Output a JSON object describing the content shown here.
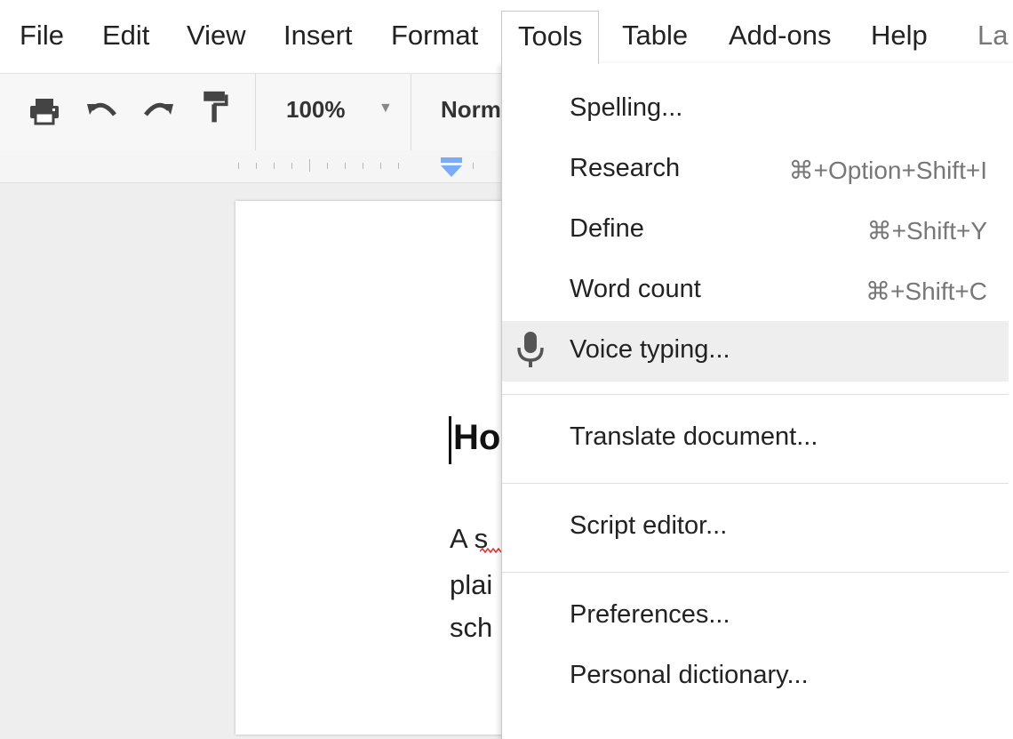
{
  "menubar": {
    "items": [
      "File",
      "Edit",
      "View",
      "Insert",
      "Format",
      "Tools",
      "Table",
      "Add-ons",
      "Help",
      "La"
    ],
    "active_index": 5
  },
  "toolbar": {
    "icons": [
      "print-icon",
      "undo-icon",
      "redo-icon",
      "paint-format-icon"
    ],
    "zoom": "100%",
    "style": "Norm"
  },
  "document": {
    "heading": "Ho",
    "lines": [
      "A s",
      "plai",
      "sch"
    ]
  },
  "tools_menu": {
    "items": [
      {
        "label": "Spelling...",
        "shortcut": ""
      },
      {
        "label": "Research",
        "shortcut": "⌘+Option+Shift+I"
      },
      {
        "label": "Define",
        "shortcut": "⌘+Shift+Y"
      },
      {
        "label": "Word count",
        "shortcut": "⌘+Shift+C"
      },
      {
        "label": "Voice typing...",
        "shortcut": "",
        "icon": "microphone-icon",
        "highlighted": true
      },
      {
        "label": "Translate document...",
        "shortcut": ""
      },
      {
        "label": "Script editor...",
        "shortcut": ""
      },
      {
        "label": "Preferences...",
        "shortcut": ""
      },
      {
        "label": "Personal dictionary...",
        "shortcut": ""
      }
    ]
  },
  "colors": {
    "accent_indent": "#7baaf7",
    "hover": "#eeeeee",
    "spell_underline": "#d33"
  }
}
